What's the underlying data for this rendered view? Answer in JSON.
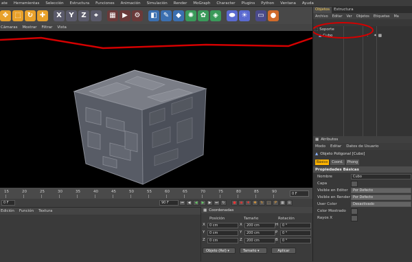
{
  "menu": [
    "ate",
    "Herramientas",
    "Selección",
    "Estructura",
    "Funciones",
    "Animación",
    "Simulación",
    "Render",
    "MoGraph",
    "Character",
    "Plugins",
    "Python",
    "Ventana",
    "Ayuda"
  ],
  "toolbar_icons": [
    {
      "name": "move-icon",
      "glyph": "✥",
      "color": "#e8a12a"
    },
    {
      "name": "scale-icon",
      "glyph": "⬚",
      "color": "#e8a12a"
    },
    {
      "name": "rotate-icon",
      "glyph": "↻",
      "color": "#e8a12a"
    },
    {
      "name": "add-icon",
      "glyph": "✚",
      "color": "#e8a12a"
    },
    {
      "name": "x-axis-icon",
      "glyph": "X",
      "color": "#5a5a6a"
    },
    {
      "name": "y-axis-icon",
      "glyph": "Y",
      "color": "#5a5a6a"
    },
    {
      "name": "z-axis-icon",
      "glyph": "Z",
      "color": "#5a5a6a"
    },
    {
      "name": "coordinate-system-icon",
      "glyph": "⌖",
      "color": "#5a5a6a"
    },
    {
      "name": "render-view-icon",
      "glyph": "▦",
      "color": "#6a3a3a"
    },
    {
      "name": "render-picture-viewer-icon",
      "glyph": "▶",
      "color": "#6a3a3a"
    },
    {
      "name": "render-settings-icon",
      "glyph": "⚙",
      "color": "#6a3a3a"
    },
    {
      "name": "cube-icon",
      "glyph": "◧",
      "color": "#3b6fb0"
    },
    {
      "name": "spline-pen-icon",
      "glyph": "✎",
      "color": "#3b6fb0"
    },
    {
      "name": "subdivision-icon",
      "glyph": "◆",
      "color": "#3b6fb0"
    },
    {
      "name": "array-icon",
      "glyph": "✺",
      "color": "#3a9a5a"
    },
    {
      "name": "deformer-icon",
      "glyph": "✿",
      "color": "#3a9a5a"
    },
    {
      "name": "environment-icon",
      "glyph": "◈",
      "color": "#3a9a5a"
    },
    {
      "name": "camera-icon",
      "glyph": "⬬",
      "color": "#5a6ad0"
    },
    {
      "name": "light-icon",
      "glyph": "☀",
      "color": "#5a6ad0"
    },
    {
      "name": "floor-icon",
      "glyph": "▭",
      "color": "#4a4a8a"
    },
    {
      "name": "render-sphere-icon",
      "glyph": "●",
      "color": "#d06a2a"
    }
  ],
  "viewport_menu": [
    "Cámaras",
    "Mostrar",
    "Filtrar",
    "Vista"
  ],
  "timeline": {
    "ticks": [
      "15",
      "20",
      "25",
      "30",
      "35",
      "40",
      "45",
      "50",
      "55",
      "60",
      "65",
      "70",
      "75",
      "80",
      "85",
      "90"
    ],
    "end_frame": "0 F"
  },
  "transport": {
    "start": "0 F",
    "end": "90 F"
  },
  "material_menu": [
    "Edición",
    "Función",
    "Textura"
  ],
  "coordinates": {
    "title": "Coordenadas",
    "headers": [
      "Posición",
      "Tamaño",
      "Rotación"
    ],
    "rows": [
      {
        "axis": "X",
        "pos": "0 cm",
        "size": "200 cm",
        "rot_axis": "H",
        "rot": "0 °"
      },
      {
        "axis": "Y",
        "pos": "0 cm",
        "size": "200 cm",
        "rot_axis": "P",
        "rot": "0 °"
      },
      {
        "axis": "Z",
        "pos": "0 cm",
        "size": "200 cm",
        "rot_axis": "B",
        "rot": "0 °"
      }
    ],
    "mode": "Objeto (Rel)",
    "size_mode": "Tamaño",
    "apply": "Aplicar"
  },
  "right_panel": {
    "tabs": [
      "Objetos",
      "Estructura"
    ],
    "menu": [
      "Archivo",
      "Editar",
      "Ver",
      "Objetos",
      "Etiquetas",
      "Ma"
    ],
    "objects": [
      "Soporte",
      "Cubo"
    ],
    "attr_title": "Atributos",
    "attr_menu": [
      "Modo",
      "Editar",
      "Datos de Usuario"
    ],
    "object_type": "Objeto Poligonal [Cubo]",
    "attr_tabs": [
      "Básico",
      "Coord.",
      "Phong"
    ],
    "section": "Propiedades Básicas",
    "props": [
      {
        "label": "Nombre",
        "value": "Cubo"
      },
      {
        "label": "Capa",
        "value": ""
      },
      {
        "label": "Visible en Editor",
        "value": "Por Defecto"
      },
      {
        "label": "Visible en Render",
        "value": "Por Defecto"
      },
      {
        "label": "User Color",
        "value": "Desactivado"
      },
      {
        "label": "Color Mostrado",
        "value": ""
      },
      {
        "label": "Rayos X",
        "value": ""
      }
    ]
  },
  "colors": {
    "highlight_red": "#d40000",
    "accent_orange": "#ffb400"
  }
}
